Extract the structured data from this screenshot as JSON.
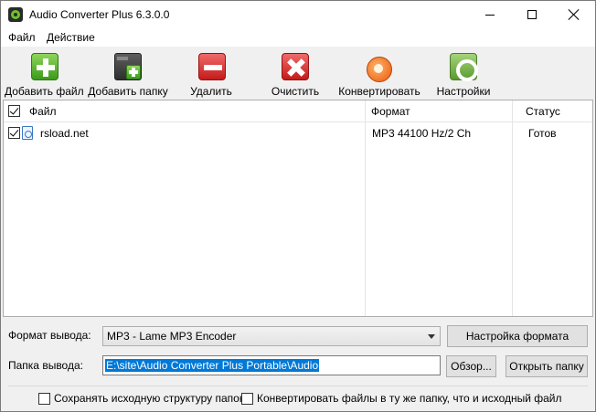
{
  "window": {
    "title": "Audio Converter Plus 6.3.0.0"
  },
  "menu": {
    "items": [
      "Файл",
      "Действие"
    ]
  },
  "toolbar": {
    "add_file": "Добавить файл",
    "add_folder": "Добавить папку",
    "remove": "Удалить",
    "clear": "Очистить",
    "convert": "Конвертировать",
    "settings": "Настройки"
  },
  "file_list": {
    "columns": [
      "Файл",
      "Формат",
      "Статус"
    ],
    "header_checked": true,
    "rows": [
      {
        "checked": true,
        "file": "rsload.net",
        "format": "MP3 44100 Hz/2 Ch",
        "status": "Готов"
      }
    ]
  },
  "output": {
    "format_label": "Формат вывода:",
    "format_value": "MP3  - Lame MP3 Encoder",
    "format_settings_button": "Настройка формата",
    "folder_label": "Папка вывода:",
    "folder_value": "E:\\site\\Audio Converter Plus Portable\\Audio",
    "browse_button": "Обзор...",
    "open_folder_button": "Открыть папку"
  },
  "options": {
    "keep_structure": {
      "label": "Сохранять исходную структуру папок",
      "checked": false
    },
    "same_folder": {
      "label": "Конвертировать файлы в ту же папку, что и исходный файл",
      "checked": false
    }
  }
}
